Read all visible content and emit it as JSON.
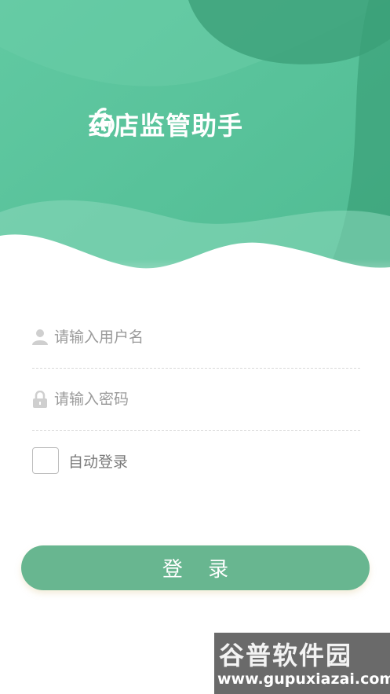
{
  "app": {
    "title": "药店监管助手"
  },
  "colors": {
    "primary": "#68b690",
    "hero_green": "#5cc49c",
    "hero_dark": "#3a9f77"
  },
  "form": {
    "username_placeholder": "请输入用户名",
    "password_placeholder": "请输入密码",
    "remember_label": "自动登录",
    "remember_checked": false,
    "login_button": "登 录"
  },
  "icons": {
    "logo": "medicine-pouch-plus-icon",
    "user": "user-icon",
    "lock": "lock-icon"
  },
  "watermark": {
    "title": "谷普软件园",
    "url": "www.gupuxiazai.com"
  }
}
